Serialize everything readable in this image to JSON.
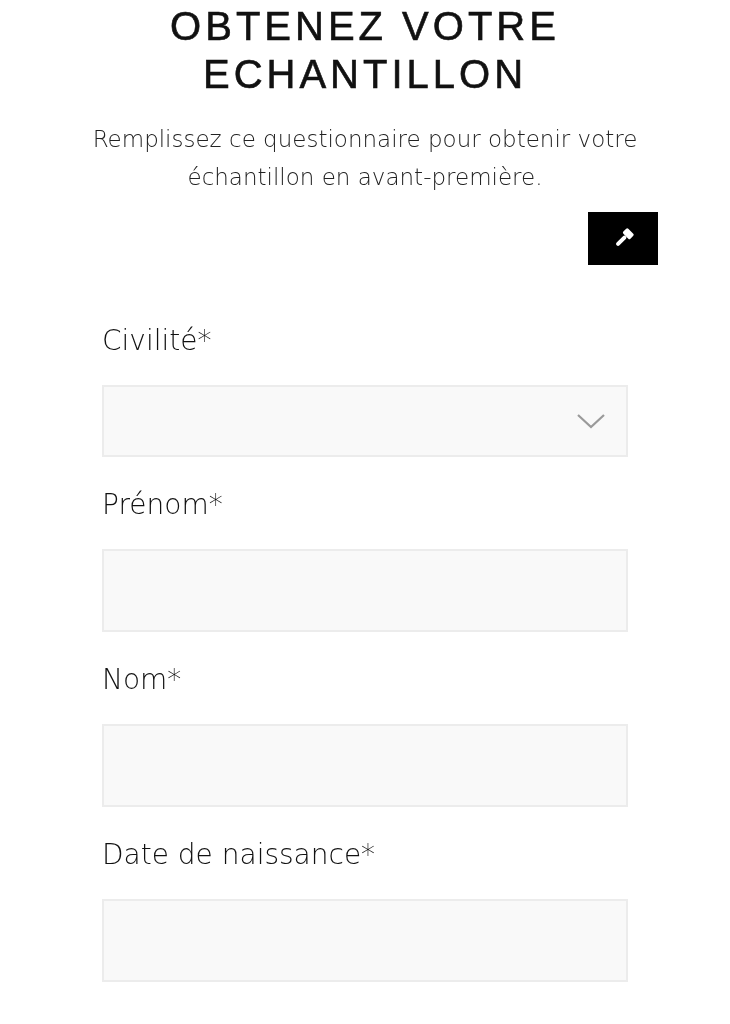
{
  "heading": [
    "OBTENEZ VOTRE",
    "ECHANTILLON"
  ],
  "intro": "Remplissez ce questionnaire pour obtenir votre échantillon en avant-première.",
  "fields": [
    {
      "label": "Civilité*",
      "kind": "select"
    },
    {
      "label": "Prénom*",
      "kind": "text"
    },
    {
      "label": "Nom*",
      "kind": "text"
    },
    {
      "label": "Date de naissance*",
      "kind": "text"
    }
  ]
}
